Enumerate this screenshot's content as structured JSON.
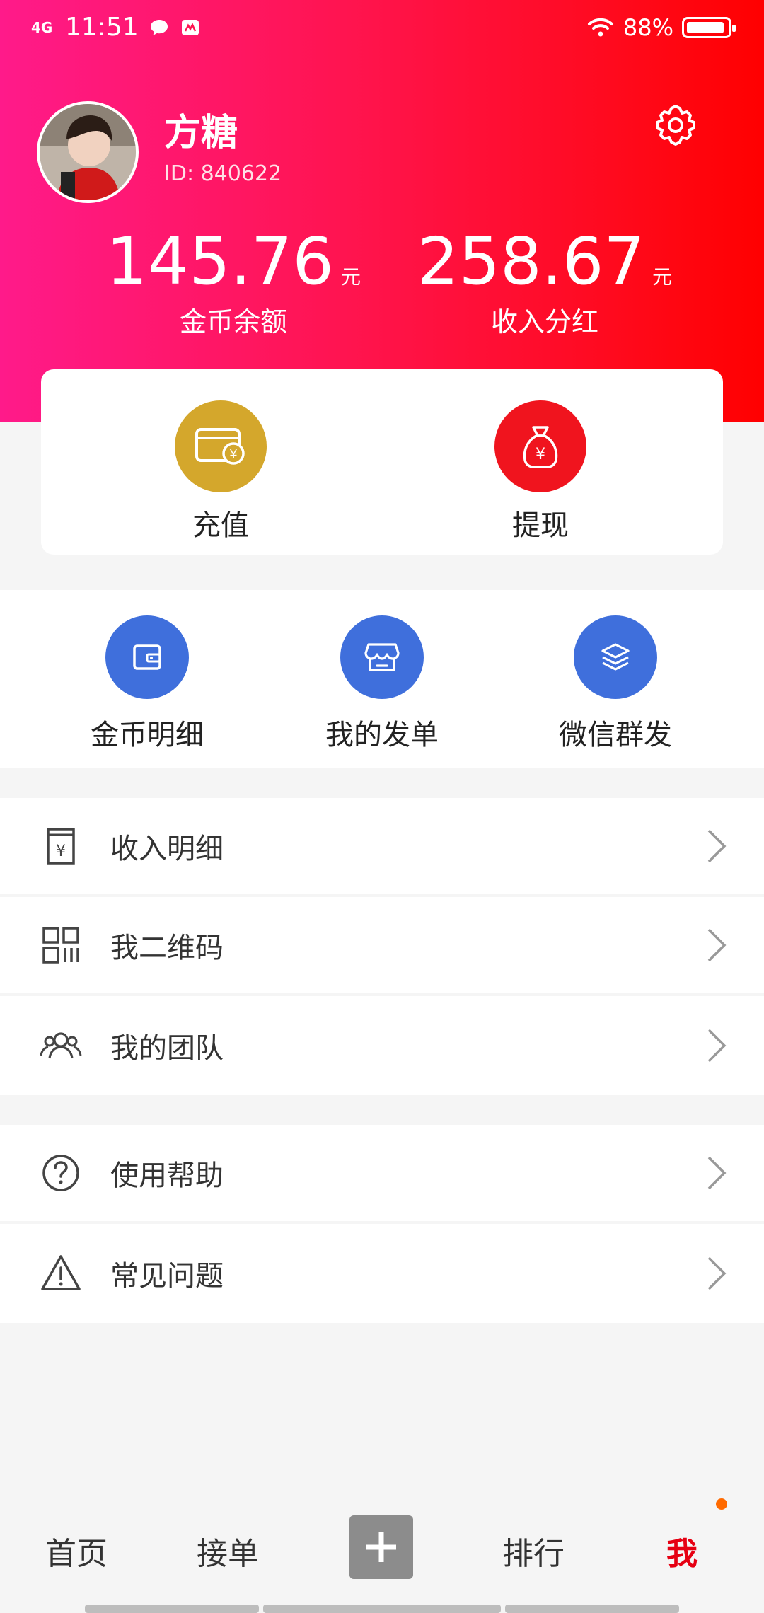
{
  "status_bar": {
    "network": "4G",
    "time": "11:51",
    "battery_percent": "88%"
  },
  "profile": {
    "name": "方糖",
    "id_text": "ID: 840622"
  },
  "stats": [
    {
      "value": "145.76",
      "unit": "元",
      "label": "金币余额"
    },
    {
      "value": "258.67",
      "unit": "元",
      "label": "收入分红"
    }
  ],
  "actions": [
    {
      "label": "充值",
      "icon": "wallet-yen-icon",
      "color": "#d4a72c"
    },
    {
      "label": "提现",
      "icon": "money-bag-icon",
      "color": "#f0141e"
    }
  ],
  "quick": [
    {
      "label": "金币明细",
      "icon": "wallet-icon"
    },
    {
      "label": "我的发单",
      "icon": "store-icon"
    },
    {
      "label": "微信群发",
      "icon": "layers-icon"
    }
  ],
  "menu_group1": [
    {
      "label": "收入明细",
      "icon": "receipt-yen-icon"
    },
    {
      "label": "我二维码",
      "icon": "qrcode-icon"
    },
    {
      "label": "我的团队",
      "icon": "team-icon"
    }
  ],
  "menu_group2": [
    {
      "label": "使用帮助",
      "icon": "help-circle-icon"
    },
    {
      "label": "常见问题",
      "icon": "warning-icon"
    }
  ],
  "nav": [
    {
      "label": "首页",
      "active": false
    },
    {
      "label": "接单",
      "active": false
    },
    {
      "label": "排行",
      "active": false
    },
    {
      "label": "我",
      "active": true
    }
  ],
  "colors": {
    "accent": "#e60012",
    "quick_icon_bg": "#3f6fdc"
  }
}
